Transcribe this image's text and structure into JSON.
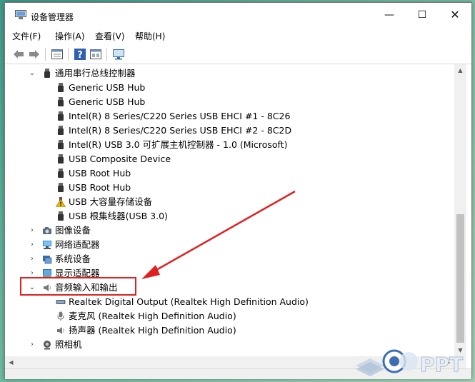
{
  "window": {
    "title": "设备管理器",
    "minimize_glyph": "—",
    "maximize_glyph": "☐",
    "close_glyph": "✕"
  },
  "menu": [
    "文件(F)",
    "操作(A)",
    "查看(V)",
    "帮助(H)"
  ],
  "toolbar": [
    "back-icon",
    "forward-icon",
    "properties-icon",
    "help-icon",
    "view-icon",
    "monitor-icon"
  ],
  "tree": {
    "usb_controllers": {
      "label": "通用串行总线控制器",
      "children": [
        "Generic USB Hub",
        "Generic USB Hub",
        "Intel(R) 8 Series/C220 Series USB EHCI #1 - 8C26",
        "Intel(R) 8 Series/C220 Series USB EHCI #2 - 8C2D",
        "Intel(R) USB 3.0 可扩展主机控制器 - 1.0 (Microsoft)",
        "USB Composite Device",
        "USB Root Hub",
        "USB Root Hub",
        "USB 大容量存储设备",
        "USB 根集线器(USB 3.0)"
      ]
    },
    "imaging": "图像设备",
    "network": "网络适配器",
    "system": "系统设备",
    "display": "显示适配器",
    "audio": {
      "label": "音频输入和输出",
      "children": [
        "Realtek Digital Output (Realtek High Definition Audio)",
        "麦克风 (Realtek High Definition Audio)",
        "扬声器 (Realtek High Definition Audio)"
      ]
    },
    "camera": "照相机"
  },
  "watermark": "PPT",
  "colors": {
    "highlight": "#e02020",
    "warning": "#f2b705"
  }
}
